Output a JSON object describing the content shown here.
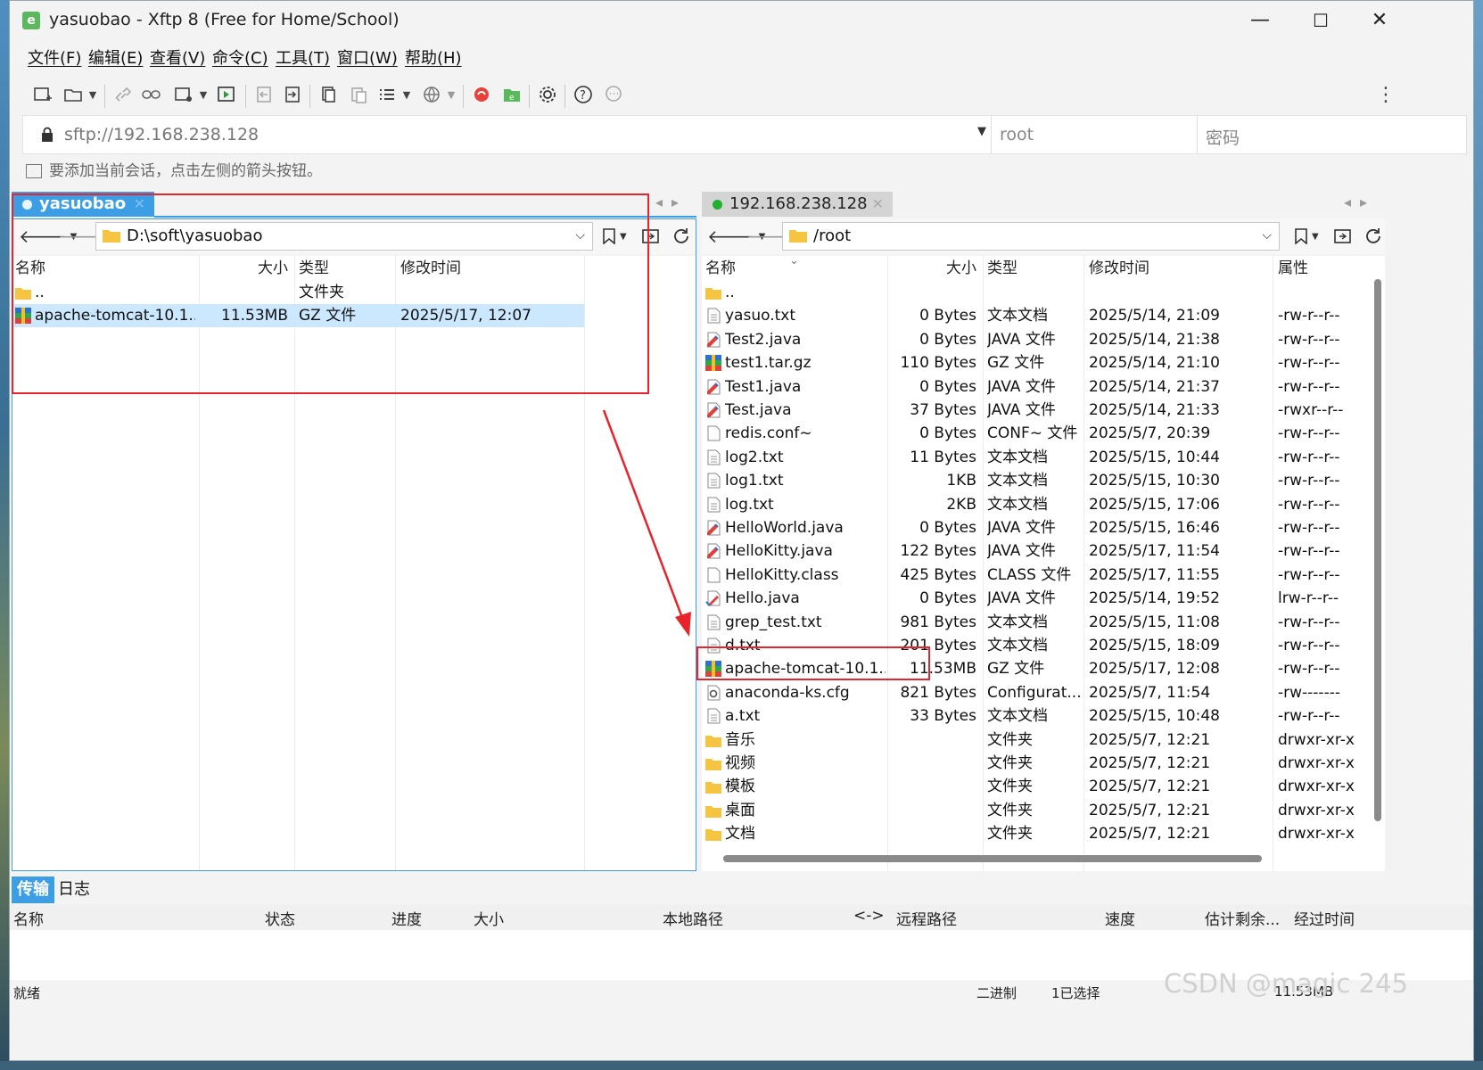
{
  "window": {
    "title": "yasuobao - Xftp 8 (Free for Home/School)",
    "app_letter": "e",
    "minimize": "—",
    "maximize": "☐",
    "close": "✕"
  },
  "menu": [
    "文件(F)",
    "编辑(E)",
    "查看(V)",
    "命令(C)",
    "工具(T)",
    "窗口(W)",
    "帮助(H)"
  ],
  "address": {
    "host": "sftp://192.168.238.128",
    "user_placeholder": "root",
    "password_placeholder": "密码"
  },
  "hint": "要添加当前会话，点击左侧的箭头按钮。",
  "left_pane": {
    "tab": "yasuobao",
    "path": "D:\\soft\\yasuobao",
    "columns": [
      "名称",
      "大小",
      "类型",
      "修改时间"
    ],
    "rows": [
      {
        "name": "..",
        "size": "",
        "type": "文件夹",
        "modified": "",
        "icon": "folder-icon"
      },
      {
        "name": "apache-tomcat-10.1...",
        "size": "11.53MB",
        "type": "GZ 文件",
        "modified": "2025/5/17, 12:07",
        "icon": "archive-icon"
      }
    ]
  },
  "right_pane": {
    "tab": "192.168.238.128",
    "path": "/root",
    "columns": [
      "名称",
      "大小",
      "类型",
      "修改时间",
      "属性"
    ],
    "rows": [
      {
        "name": "..",
        "size": "",
        "type": "",
        "modified": "",
        "attr": "",
        "icon": "folder-icon"
      },
      {
        "name": "yasuo.txt",
        "size": "0 Bytes",
        "type": "文本文档",
        "modified": "2025/5/14, 21:09",
        "attr": "-rw-r--r--",
        "icon": "text-file-icon"
      },
      {
        "name": "Test2.java",
        "size": "0 Bytes",
        "type": "JAVA 文件",
        "modified": "2025/5/14, 21:38",
        "attr": "-rw-r--r--",
        "icon": "java-file-icon"
      },
      {
        "name": "test1.tar.gz",
        "size": "110 Bytes",
        "type": "GZ 文件",
        "modified": "2025/5/14, 21:10",
        "attr": "-rw-r--r--",
        "icon": "archive-icon"
      },
      {
        "name": "Test1.java",
        "size": "0 Bytes",
        "type": "JAVA 文件",
        "modified": "2025/5/14, 21:37",
        "attr": "-rw-r--r--",
        "icon": "java-file-icon"
      },
      {
        "name": "Test.java",
        "size": "37 Bytes",
        "type": "JAVA 文件",
        "modified": "2025/5/14, 21:33",
        "attr": "-rwxr--r--",
        "icon": "java-file-icon"
      },
      {
        "name": "redis.conf~",
        "size": "0 Bytes",
        "type": "CONF~ 文件",
        "modified": "2025/5/7, 20:39",
        "attr": "-rw-r--r--",
        "icon": "blank-file-icon"
      },
      {
        "name": "log2.txt",
        "size": "11 Bytes",
        "type": "文本文档",
        "modified": "2025/5/15, 10:44",
        "attr": "-rw-r--r--",
        "icon": "text-file-icon"
      },
      {
        "name": "log1.txt",
        "size": "1KB",
        "type": "文本文档",
        "modified": "2025/5/15, 10:30",
        "attr": "-rw-r--r--",
        "icon": "text-file-icon"
      },
      {
        "name": "log.txt",
        "size": "2KB",
        "type": "文本文档",
        "modified": "2025/5/15, 17:06",
        "attr": "-rw-r--r--",
        "icon": "text-file-icon"
      },
      {
        "name": "HelloWorld.java",
        "size": "0 Bytes",
        "type": "JAVA 文件",
        "modified": "2025/5/15, 16:46",
        "attr": "-rw-r--r--",
        "icon": "java-file-icon"
      },
      {
        "name": "HelloKitty.java",
        "size": "122 Bytes",
        "type": "JAVA 文件",
        "modified": "2025/5/17, 11:54",
        "attr": "-rw-r--r--",
        "icon": "java-file-icon"
      },
      {
        "name": "HelloKitty.class",
        "size": "425 Bytes",
        "type": "CLASS 文件",
        "modified": "2025/5/17, 11:55",
        "attr": "-rw-r--r--",
        "icon": "blank-file-icon"
      },
      {
        "name": "Hello.java",
        "size": "0 Bytes",
        "type": "JAVA 文件",
        "modified": "2025/5/14, 19:52",
        "attr": "lrw-r--r--",
        "icon": "java-link-icon"
      },
      {
        "name": "grep_test.txt",
        "size": "981 Bytes",
        "type": "文本文档",
        "modified": "2025/5/15, 11:08",
        "attr": "-rw-r--r--",
        "icon": "text-file-icon"
      },
      {
        "name": "d.txt",
        "size": "201 Bytes",
        "type": "文本文档",
        "modified": "2025/5/15, 18:09",
        "attr": "-rw-r--r--",
        "icon": "text-file-icon"
      },
      {
        "name": "apache-tomcat-10.1...",
        "size": "11.53MB",
        "type": "GZ 文件",
        "modified": "2025/5/17, 12:08",
        "attr": "-rw-r--r--",
        "icon": "archive-icon"
      },
      {
        "name": "anaconda-ks.cfg",
        "size": "821 Bytes",
        "type": "Configurat...",
        "modified": "2025/5/7, 11:54",
        "attr": "-rw-------",
        "icon": "config-file-icon"
      },
      {
        "name": "a.txt",
        "size": "33 Bytes",
        "type": "文本文档",
        "modified": "2025/5/15, 10:48",
        "attr": "-rw-r--r--",
        "icon": "text-file-icon"
      },
      {
        "name": "音乐",
        "size": "",
        "type": "文件夹",
        "modified": "2025/5/7, 12:21",
        "attr": "drwxr-xr-x",
        "icon": "folder-icon"
      },
      {
        "name": "视频",
        "size": "",
        "type": "文件夹",
        "modified": "2025/5/7, 12:21",
        "attr": "drwxr-xr-x",
        "icon": "folder-icon"
      },
      {
        "name": "模板",
        "size": "",
        "type": "文件夹",
        "modified": "2025/5/7, 12:21",
        "attr": "drwxr-xr-x",
        "icon": "folder-icon"
      },
      {
        "name": "桌面",
        "size": "",
        "type": "文件夹",
        "modified": "2025/5/7, 12:21",
        "attr": "drwxr-xr-x",
        "icon": "folder-icon"
      },
      {
        "name": "文档",
        "size": "",
        "type": "文件夹",
        "modified": "2025/5/7, 12:21",
        "attr": "drwxr-xr-x",
        "icon": "folder-icon"
      }
    ]
  },
  "transfer": {
    "tabs": [
      "传输",
      "日志"
    ],
    "columns": [
      "名称",
      "状态",
      "进度",
      "大小",
      "本地路径",
      "<->",
      "远程路径",
      "速度",
      "估计剩余...",
      "经过时间"
    ]
  },
  "status": {
    "ready": "就绪",
    "mode": "二进制",
    "selected": "1已选择",
    "size": "11.53MB"
  },
  "watermark": "CSDN @magic 245",
  "colors": {
    "accent": "#3c9ee5",
    "selection": "#cce8ff",
    "annotation_red": "#e8232b",
    "connected_green": "#20b030"
  }
}
